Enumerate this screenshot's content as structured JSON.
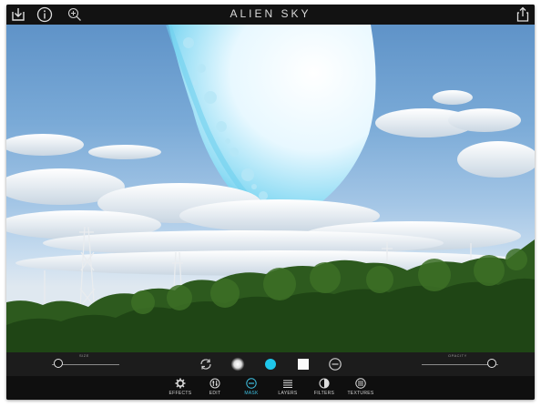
{
  "app": {
    "title": "ALIEN SKY"
  },
  "topbar": {
    "left_icons": [
      "download-icon",
      "info-icon",
      "zoom-in-icon"
    ],
    "right_icons": [
      "share-icon"
    ]
  },
  "controls": {
    "size_label": "SIZE",
    "size_value": 0.1,
    "opacity_label": "OPACITY",
    "opacity_value": 0.92,
    "tools": [
      "rotate-icon",
      "soft-brush-icon",
      "color-swatch-icon",
      "hard-brush-icon",
      "erase-icon"
    ],
    "selected_color": "#1fc6ea"
  },
  "tabs": [
    {
      "label": "EFFECTS",
      "icon": "gear-icon",
      "active": false
    },
    {
      "label": "EDIT",
      "icon": "adjust-icon",
      "active": false
    },
    {
      "label": "MASK",
      "icon": "mask-icon",
      "active": true
    },
    {
      "label": "LAYERS",
      "icon": "layers-icon",
      "active": false
    },
    {
      "label": "FILTERS",
      "icon": "filters-icon",
      "active": false
    },
    {
      "label": "TEXTURES",
      "icon": "textures-icon",
      "active": false
    }
  ],
  "colors": {
    "accent": "#3fbfe0",
    "bar": "#1c1c1c"
  }
}
